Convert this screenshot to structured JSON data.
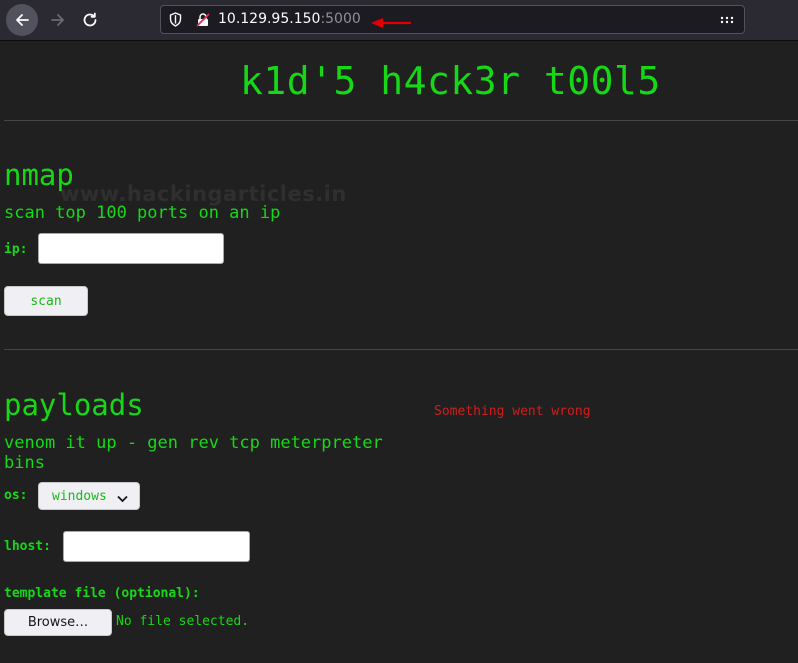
{
  "browser": {
    "url_host": "10.129.95.150",
    "url_port": ":5000",
    "annotation_color": "#e00000"
  },
  "page": {
    "title": "k1d'5 h4ck3r t00l5",
    "watermark": "www.hackingarticles.in",
    "nmap": {
      "heading": "nmap",
      "description": "scan top 100 ports on an ip",
      "ip_label": "ip:",
      "ip_value": "",
      "scan_button": "scan"
    },
    "payloads": {
      "heading": "payloads",
      "description_line1": "venom it up - gen rev tcp meterpreter",
      "description_line2": "bins",
      "os_label": "os:",
      "os_selected": "windows",
      "lhost_label": "lhost:",
      "lhost_value": "",
      "template_label": "template file (optional):",
      "browse_button": "Browse…",
      "file_status": "No file selected."
    },
    "error": "Something went wrong"
  },
  "colors": {
    "accent_green": "#17d817",
    "error_red": "#d21d1d",
    "page_bg": "#202020",
    "toolbar_bg": "#2b2a33"
  },
  "icons": [
    "back-arrow-icon",
    "forward-arrow-icon",
    "reload-icon",
    "shield-icon",
    "insecure-lock-icon",
    "red-arrow-icon",
    "more-options-icon",
    "chevron-down-icon"
  ]
}
